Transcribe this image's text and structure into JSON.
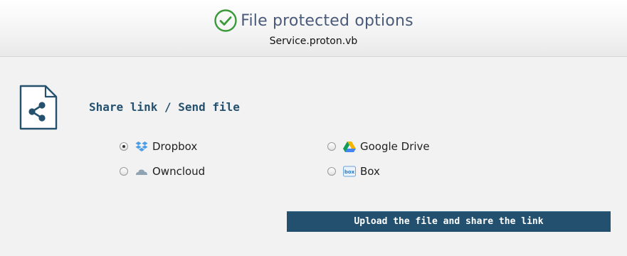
{
  "header": {
    "title": "File protected options",
    "subtitle": "Service.proton.vb"
  },
  "section": {
    "title": "Share link / Send file"
  },
  "options": [
    {
      "label": "Dropbox",
      "icon": "dropbox-icon",
      "selected": true
    },
    {
      "label": "Google Drive",
      "icon": "google-drive-icon",
      "selected": false
    },
    {
      "label": "Owncloud",
      "icon": "owncloud-icon",
      "selected": false
    },
    {
      "label": "Box",
      "icon": "box-icon",
      "selected": false
    }
  ],
  "upload_button": {
    "label": "Upload the file and share the link"
  },
  "colors": {
    "accent": "#22506e",
    "success": "#3a9a3a"
  }
}
